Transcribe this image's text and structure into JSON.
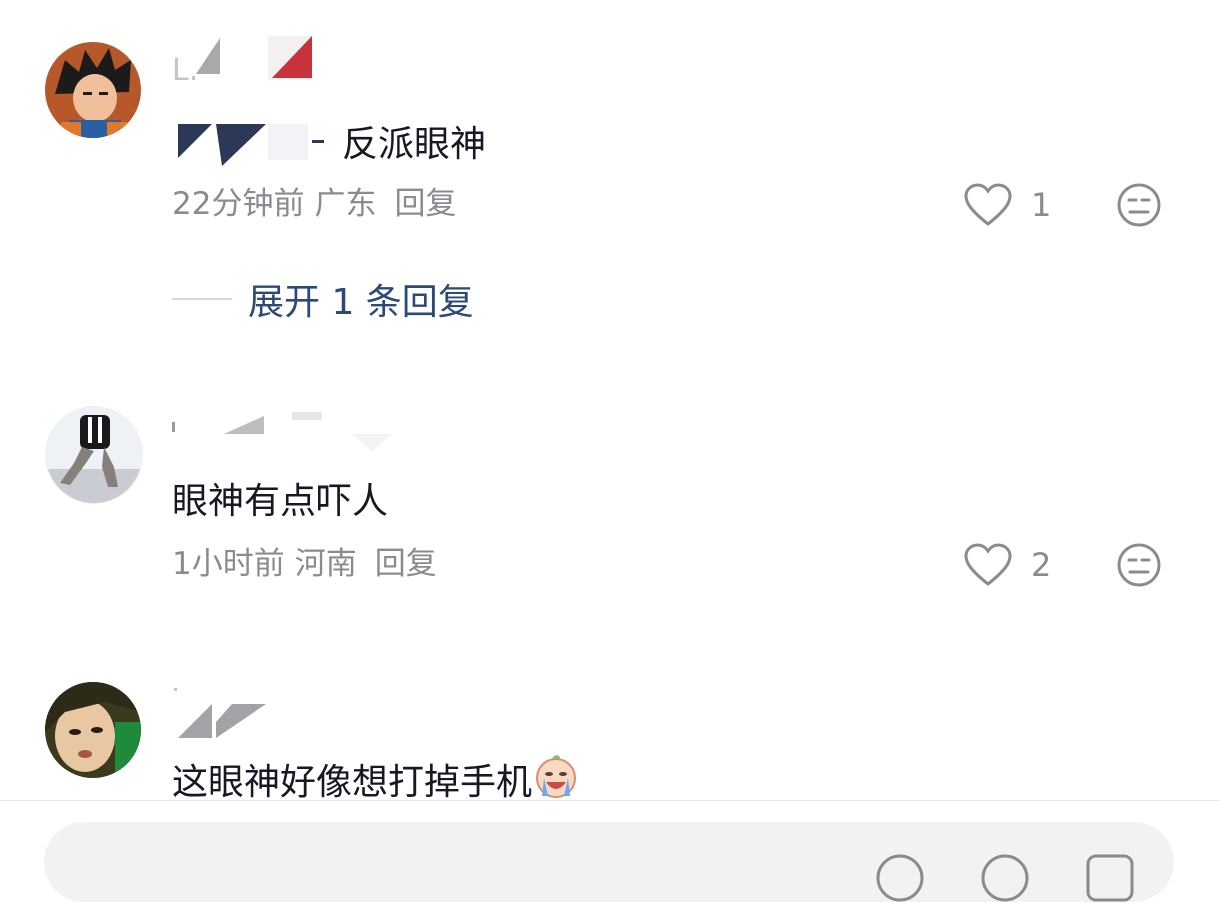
{
  "comments": [
    {
      "text": "反派眼神",
      "time": "22分钟前",
      "location": "广东",
      "reply_label": "回复",
      "likes": "1",
      "expand_label": "展开 1 条回复"
    },
    {
      "text": "眼神有点吓人",
      "time": "1小时前",
      "location": "河南",
      "reply_label": "回复",
      "likes": "2"
    },
    {
      "text": "这眼神好像想打掉手机"
    }
  ],
  "input": {
    "placeholder": ""
  },
  "colors": {
    "link": "#2c4a76",
    "meta": "#8a8b91",
    "text": "#161823"
  }
}
